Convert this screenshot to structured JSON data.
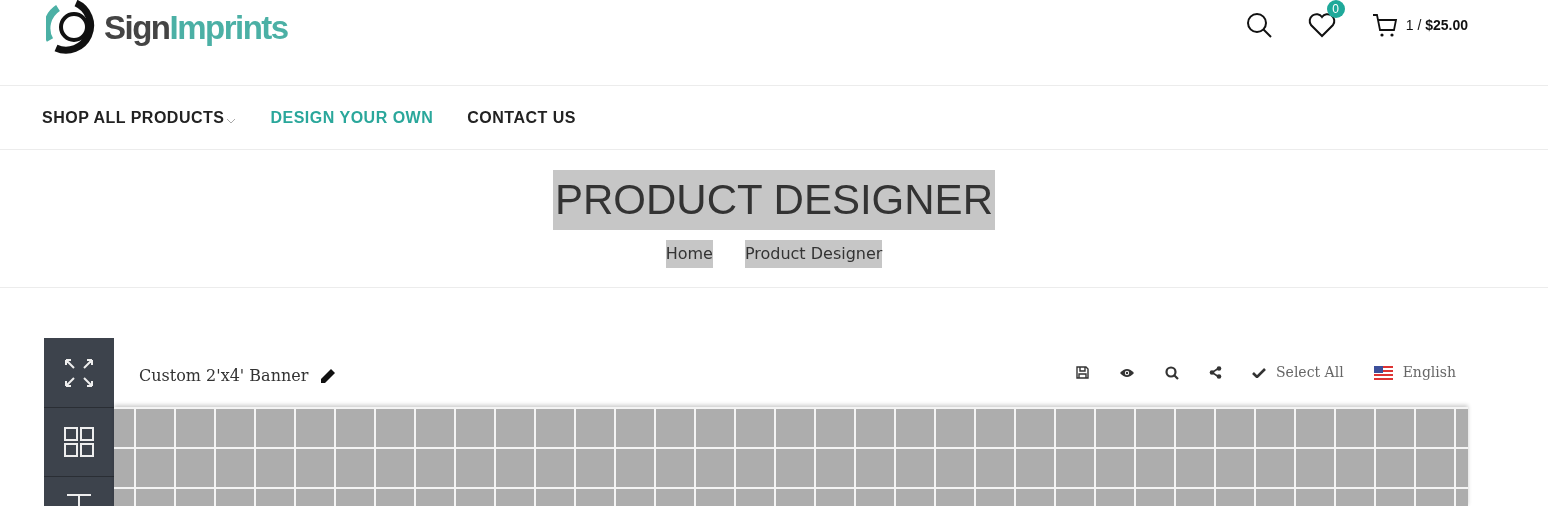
{
  "logo": {
    "part_1": "Sign",
    "part_2": "Imprints"
  },
  "header": {
    "wishlist_count": "0",
    "cart_count": "1 /",
    "cart_total": "$25.00"
  },
  "nav": [
    {
      "label": "SHOP ALL PRODUCTS",
      "selected": false,
      "has_dropdown": true
    },
    {
      "label": "DESIGN YOUR OWN",
      "selected": true,
      "has_dropdown": false
    },
    {
      "label": "CONTACT US",
      "selected": false,
      "has_dropdown": false
    }
  ],
  "page_title": "PRODUCT DESIGNER",
  "breadcrumb": [
    "Home",
    "Product Designer"
  ],
  "designer": {
    "sidebar": [
      {
        "kind": "fullscreen"
      },
      {
        "kind": "layouts"
      },
      {
        "kind": "text"
      }
    ],
    "product_title": "Custom 2'x4' Banner",
    "toolbar": [
      {
        "kind": "save"
      },
      {
        "kind": "preview"
      },
      {
        "kind": "zoom"
      },
      {
        "kind": "share"
      },
      {
        "kind": "select",
        "label": "Select All"
      },
      {
        "kind": "language",
        "label": "English"
      }
    ]
  }
}
